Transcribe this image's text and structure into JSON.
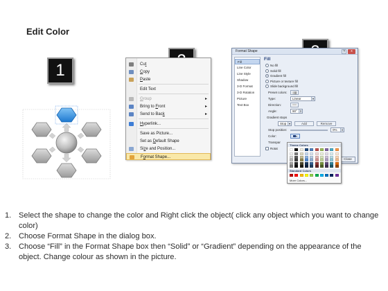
{
  "title": "Edit Color",
  "steps": [
    "1",
    "2",
    "3"
  ],
  "context_menu": {
    "items": [
      {
        "label": "Cut",
        "accel": "t",
        "icon": "cut-icon",
        "icon_color": "#7f7f7f"
      },
      {
        "label": "Copy",
        "accel": "C",
        "icon": "copy-icon",
        "icon_color": "#6f8fbf"
      },
      {
        "label": "Paste",
        "accel": "P",
        "icon": "paste-icon",
        "icon_color": "#c9a25a"
      },
      {
        "label": "Edit Text",
        "icon": "",
        "icon_color": ""
      },
      {
        "label": "Group",
        "accel": "G",
        "icon": "group-icon",
        "icon_color": "#b9b9b9",
        "disabled": true,
        "submenu": true
      },
      {
        "label": "Bring to Front",
        "accel": "F",
        "icon": "bring-front-icon",
        "icon_color": "#5b84c4",
        "submenu": true
      },
      {
        "label": "Send to Back",
        "accel": "k",
        "icon": "send-back-icon",
        "icon_color": "#5b84c4",
        "submenu": true
      },
      {
        "label": "Hyperlink...",
        "accel": "H",
        "icon": "hyperlink-icon",
        "icon_color": "#3d7dd6"
      },
      {
        "label": "Save as Picture...",
        "icon": "",
        "icon_color": ""
      },
      {
        "label": "Set as Default Shape",
        "accel": "D",
        "icon": "",
        "icon_color": ""
      },
      {
        "label": "Size and Position...",
        "accel": "z",
        "icon": "size-icon",
        "icon_color": "#8aa7d1"
      },
      {
        "label": "Format Shape...",
        "accel": "o",
        "icon": "format-shape-icon",
        "icon_color": "#e3a33a",
        "highlighted": true
      }
    ]
  },
  "format_dialog": {
    "title": "Format Shape",
    "help": "?",
    "close_glyph": "x",
    "categories": [
      "Fill",
      "Line Color",
      "Line Style",
      "Shadow",
      "3-D Format",
      "3-D Rotation",
      "Picture",
      "Text Box"
    ],
    "selected_category": "Fill",
    "section_title": "Fill",
    "fill_options": [
      {
        "label": "No fill",
        "accel": "N",
        "selected": false
      },
      {
        "label": "Solid fill",
        "accel": "S",
        "selected": false
      },
      {
        "label": "Gradient fill",
        "accel": "G",
        "selected": true
      },
      {
        "label": "Picture or texture fill",
        "accel": "P",
        "selected": false
      },
      {
        "label": "Slide background fill",
        "accel": "B",
        "selected": false
      }
    ],
    "preset_colors_label": "Preset colors:",
    "type_label": "Type:",
    "type_value": "Linear",
    "direction_label": "Direction:",
    "angle_label": "Angle:",
    "angle_value": "90°",
    "gradient_stops_label": "Gradient stops",
    "stop_value": "Stop 1",
    "add_label": "Add",
    "remove_label": "Remove",
    "stop_position_label": "Stop position:",
    "stop_position_value": "0%",
    "color_label": "Color:",
    "transparency_label": "Transpar",
    "rotate_label": "Rotat",
    "close_button": "Close"
  },
  "palette": {
    "theme_title": "Theme Colors",
    "standard_title": "Standard Colors",
    "more_colors": "More Colors...",
    "theme_top": [
      "#ffffff",
      "#000000",
      "#eeece1",
      "#1f497d",
      "#4f81bd",
      "#c0504d",
      "#9bbb59",
      "#8064a2",
      "#4bacc6",
      "#f79646"
    ],
    "theme_shades": [
      [
        "#f2f2f2",
        "#7f7f7f",
        "#ddd9c3",
        "#c6d9f0",
        "#dbe5f1",
        "#f2dcdb",
        "#ebf1dd",
        "#e5e0ec",
        "#dbeef3",
        "#fdeada"
      ],
      [
        "#d8d8d8",
        "#595959",
        "#c4bd97",
        "#8db3e2",
        "#b8cce4",
        "#e5b9b7",
        "#d7e3bc",
        "#ccc1d9",
        "#b7dde8",
        "#fbd5b5"
      ],
      [
        "#bfbfbf",
        "#3f3f3f",
        "#938953",
        "#548dd4",
        "#95b3d7",
        "#d99694",
        "#c3d69b",
        "#b2a2c7",
        "#92cddc",
        "#fac08f"
      ],
      [
        "#a5a5a5",
        "#262626",
        "#494429",
        "#17365d",
        "#366092",
        "#953734",
        "#76923c",
        "#5f497a",
        "#31859b",
        "#e36c09"
      ],
      [
        "#7f7f7f",
        "#0c0c0c",
        "#1d1b10",
        "#0f243e",
        "#244061",
        "#632423",
        "#4f6128",
        "#3f3151",
        "#205867",
        "#974806"
      ]
    ],
    "standard": [
      "#c00000",
      "#ff0000",
      "#ffc000",
      "#ffff00",
      "#92d050",
      "#00b050",
      "#00b0f0",
      "#0070c0",
      "#002060",
      "#7030a0"
    ]
  },
  "instructions": [
    {
      "num": "1.",
      "text": "Select the shape to change the color and Right click the object( click any object which you want to change color)"
    },
    {
      "num": "2.",
      "text": "Choose Format Shape in the dialog box."
    },
    {
      "num": "3.",
      "text": "Choose “Fill” in the Format Shape box then “Solid” or “Gradient” depending on the appearance of the object. Change colour as shown in the picture."
    }
  ]
}
